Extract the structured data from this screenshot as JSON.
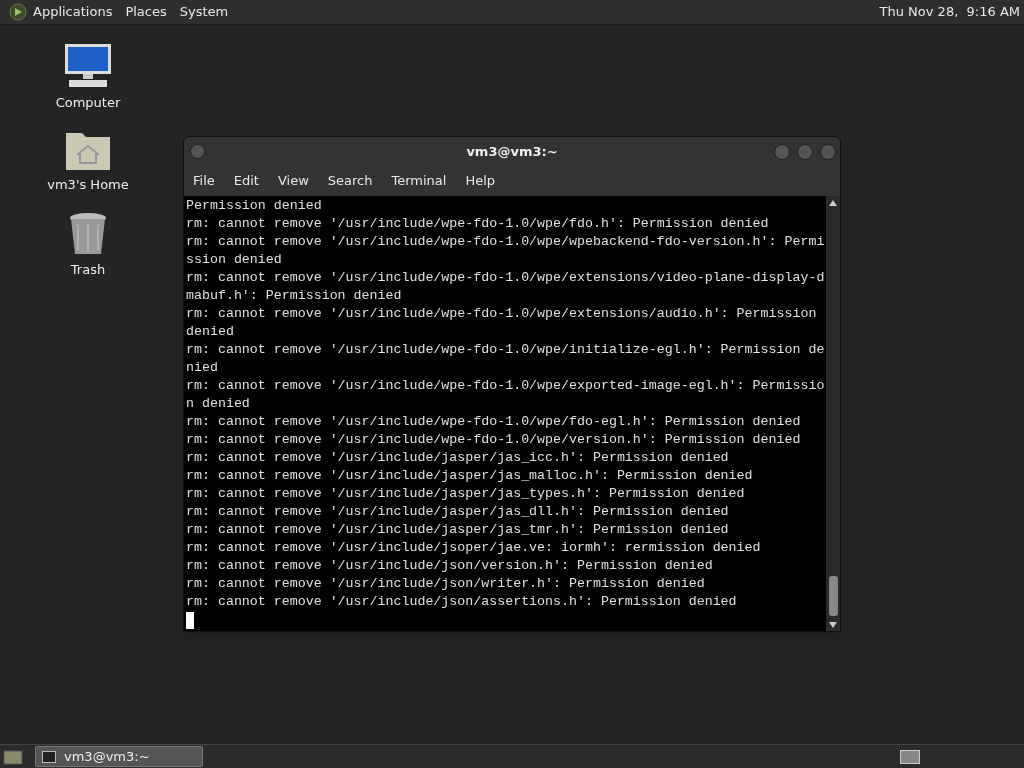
{
  "top_panel": {
    "menus": [
      "Applications",
      "Places",
      "System"
    ],
    "clock": "Thu Nov 28,  9:16 AM"
  },
  "desktop_icons": [
    {
      "kind": "computer",
      "label": "Computer"
    },
    {
      "kind": "home",
      "label": "vm3's Home"
    },
    {
      "kind": "trash",
      "label": "Trash"
    }
  ],
  "terminal": {
    "title": "vm3@vm3:~",
    "menus": [
      "File",
      "Edit",
      "View",
      "Search",
      "Terminal",
      "Help"
    ],
    "lines": [
      "Permission denied",
      "rm: cannot remove '/usr/include/wpe-fdo-1.0/wpe/fdo.h': Permission denied",
      "rm: cannot remove '/usr/include/wpe-fdo-1.0/wpe/wpebackend-fdo-version.h': Permi",
      "ssion denied",
      "rm: cannot remove '/usr/include/wpe-fdo-1.0/wpe/extensions/video-plane-display-d",
      "mabuf.h': Permission denied",
      "rm: cannot remove '/usr/include/wpe-fdo-1.0/wpe/extensions/audio.h': Permission",
      "denied",
      "rm: cannot remove '/usr/include/wpe-fdo-1.0/wpe/initialize-egl.h': Permission de",
      "nied",
      "rm: cannot remove '/usr/include/wpe-fdo-1.0/wpe/exported-image-egl.h': Permissio",
      "n denied",
      "rm: cannot remove '/usr/include/wpe-fdo-1.0/wpe/fdo-egl.h': Permission denied",
      "rm: cannot remove '/usr/include/wpe-fdo-1.0/wpe/version.h': Permission denied",
      "rm: cannot remove '/usr/include/jasper/jas_icc.h': Permission denied",
      "rm: cannot remove '/usr/include/jasper/jas_malloc.h': Permission denied",
      "rm: cannot remove '/usr/include/jasper/jas_types.h': Permission denied",
      "rm: cannot remove '/usr/include/jasper/jas_dll.h': Permission denied",
      "rm: cannot remove '/usr/include/jasper/jas_tmr.h': Permission denied",
      "rm: cannot remove '/usr/include/jsoper/jae.ve: iormh': rermission denied",
      "rm: cannot remove '/usr/include/json/version.h': Permission denied",
      "rm: cannot remove '/usr/include/json/writer.h': Permission denied",
      "rm: cannot remove '/usr/include/json/assertions.h': Permission denied"
    ]
  },
  "taskbar": {
    "windows": [
      {
        "label": "vm3@vm3:~",
        "selected": true
      }
    ]
  }
}
